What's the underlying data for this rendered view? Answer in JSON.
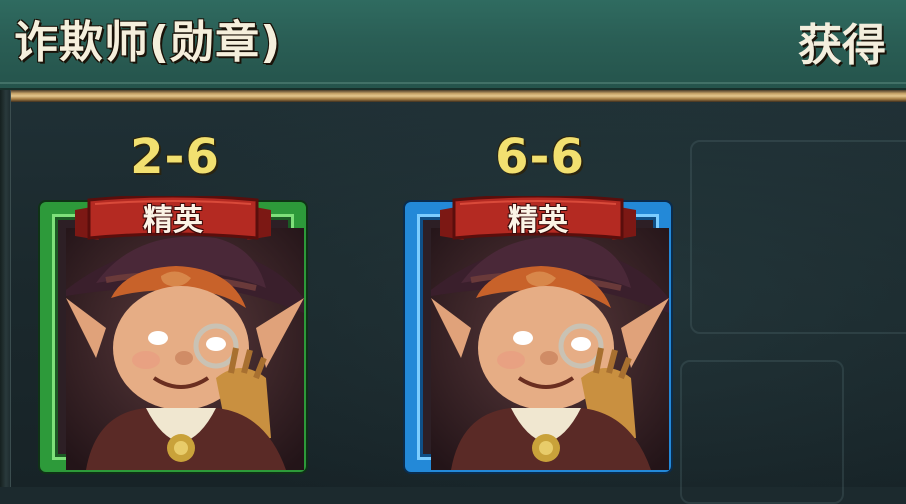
{
  "header": {
    "title": "诈欺师(勋章)",
    "right_label": "获得"
  },
  "cards": [
    {
      "stage": "2-6",
      "badge": "精英",
      "frame_color": "#2d9a3a",
      "portrait_icon": "goblin-thief-portrait-icon"
    },
    {
      "stage": "6-6",
      "badge": "精英",
      "frame_color": "#2389d8",
      "portrait_icon": "goblin-thief-portrait-icon"
    }
  ],
  "colors": {
    "header_bg": "#2a5e55",
    "stage_text": "#f2e070",
    "ribbon": "#b42a22"
  }
}
